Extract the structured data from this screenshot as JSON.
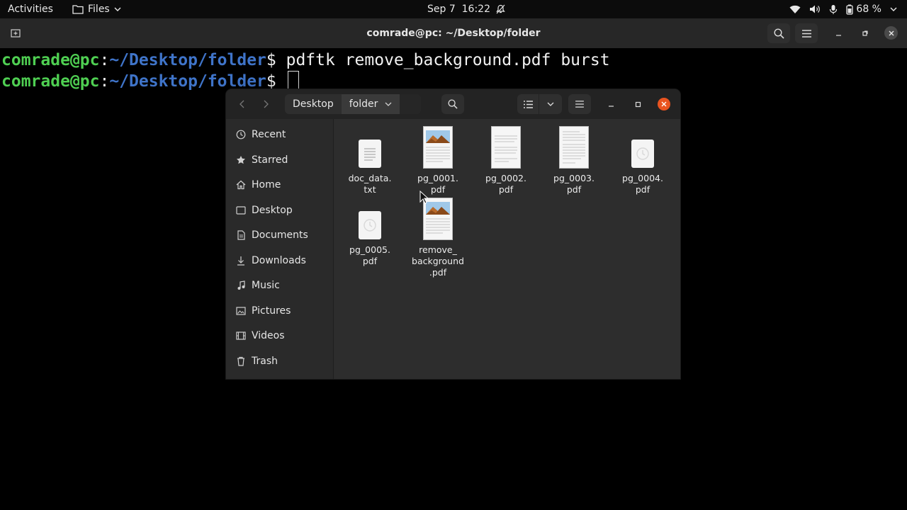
{
  "topbar": {
    "activities": "Activities",
    "app_name": "Files",
    "clock": "Sep 7  16:22",
    "battery": "68 %"
  },
  "terminal": {
    "title": "comrade@pc: ~/Desktop/folder",
    "lines": [
      {
        "user": "comrade@pc",
        "sep": ":",
        "path": "~/Desktop/folder",
        "dollar": "$ ",
        "cmd": "pdftk remove_background.pdf burst"
      },
      {
        "user": "comrade@pc",
        "sep": ":",
        "path": "~/Desktop/folder",
        "dollar": "$ ",
        "cmd": ""
      }
    ]
  },
  "file_manager": {
    "path": [
      "Desktop",
      "folder"
    ],
    "sidebar": [
      {
        "label": "Recent",
        "icon": "clock-icon"
      },
      {
        "label": "Starred",
        "icon": "star-icon"
      },
      {
        "label": "Home",
        "icon": "home-icon"
      },
      {
        "label": "Desktop",
        "icon": "desktop-icon"
      },
      {
        "label": "Documents",
        "icon": "documents-icon"
      },
      {
        "label": "Downloads",
        "icon": "download-icon"
      },
      {
        "label": "Music",
        "icon": "music-icon"
      },
      {
        "label": "Pictures",
        "icon": "pictures-icon"
      },
      {
        "label": "Videos",
        "icon": "videos-icon"
      },
      {
        "label": "Trash",
        "icon": "trash-icon"
      }
    ],
    "files": [
      {
        "name": "doc_data.\ntxt",
        "type": "text"
      },
      {
        "name": "pg_0001.\npdf",
        "type": "pdf-photo"
      },
      {
        "name": "pg_0002.\npdf",
        "type": "pdf-text"
      },
      {
        "name": "pg_0003.\npdf",
        "type": "pdf-text"
      },
      {
        "name": "pg_0004.\npdf",
        "type": "pdf-loading"
      },
      {
        "name": "pg_0005.\npdf",
        "type": "pdf-loading"
      },
      {
        "name": "remove_\nbackground\n.pdf",
        "type": "pdf-photo"
      }
    ]
  },
  "colors": {
    "prompt_user": "#4fcf52",
    "prompt_path": "#3f74c9",
    "close_accent": "#e95420"
  }
}
